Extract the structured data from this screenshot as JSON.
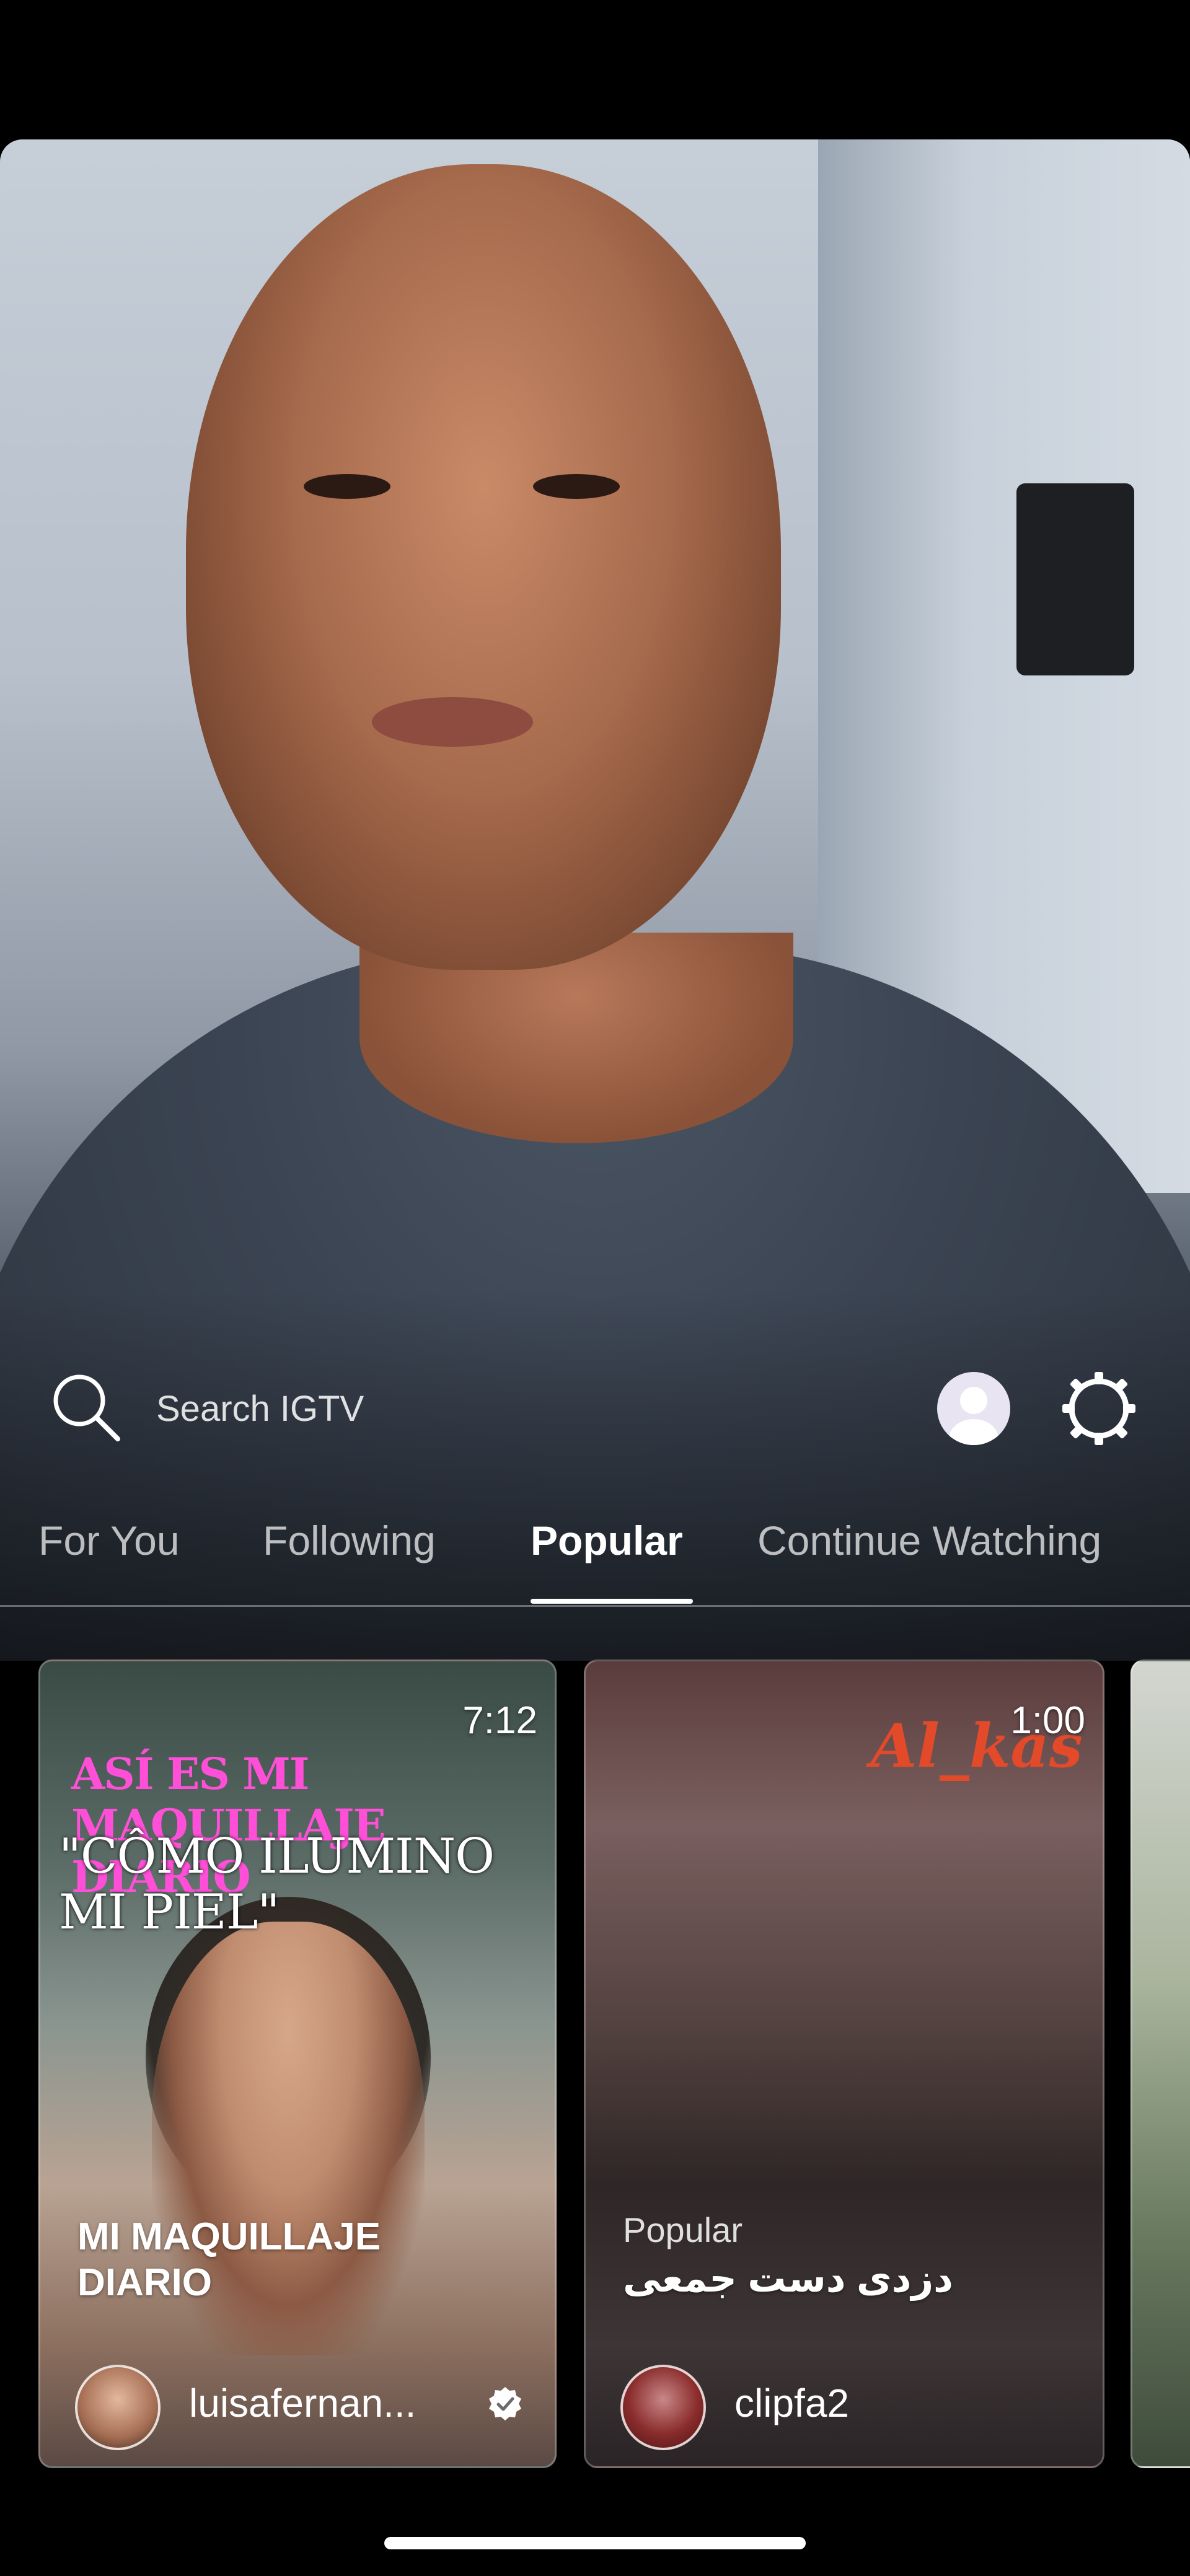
{
  "search": {
    "label": "Search IGTV"
  },
  "tabs": [
    {
      "label": "For You",
      "active": false
    },
    {
      "label": "Following",
      "active": false
    },
    {
      "label": "Popular",
      "active": true
    },
    {
      "label": "Continue Watching",
      "active": false
    }
  ],
  "cards": [
    {
      "duration": "7:12",
      "overlay_line1": "ASÍ ES MI MAQUILLAJE DIARIO",
      "overlay_line2": "\"CÔMO ILUMINO MI PIEL\"",
      "title": "MI MAQUILLAJE DIARIO",
      "handle": "luisafernan...",
      "verified": true
    },
    {
      "duration": "1:00",
      "overlay_text": "Al_kas",
      "genre": "Popular",
      "title": "دزدی دست جمعی",
      "handle": "clipfa2",
      "verified": false
    }
  ],
  "colors": {
    "background": "#000000",
    "text": "#ffffff",
    "overlay_pink": "#ff4fd8",
    "overlay_red": "#e24a2a"
  },
  "icons": [
    "search-icon",
    "profile-avatar",
    "settings-gear-icon",
    "verified-badge-icon"
  ]
}
